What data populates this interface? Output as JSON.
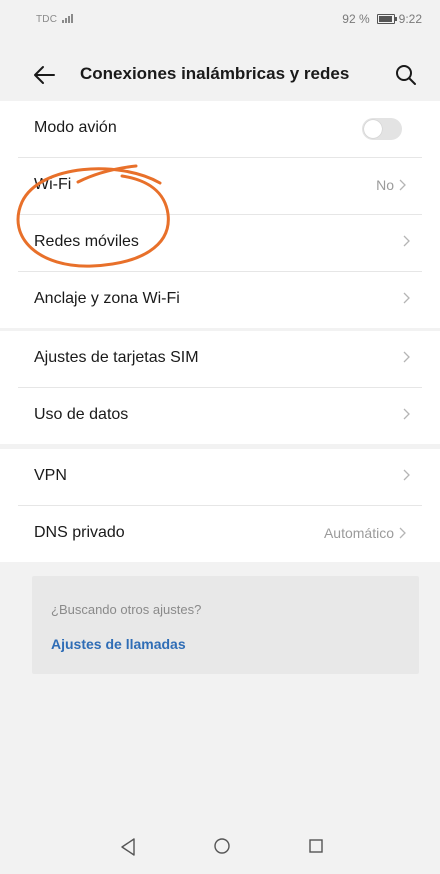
{
  "status_bar": {
    "carrier": "TDC",
    "battery": "92 %",
    "battery_level": 0.92,
    "time": "9:22"
  },
  "header": {
    "title": "Conexiones inalámbricas y redes",
    "back_icon": "arrow-left-icon",
    "search_icon": "search-icon"
  },
  "groups": [
    {
      "items": [
        {
          "label": "Modo avión",
          "control": "toggle",
          "toggle_on": false
        },
        {
          "label": "Wi-Fi",
          "value": "No"
        },
        {
          "label": "Redes móviles",
          "value": ""
        },
        {
          "label": "Anclaje y zona Wi-Fi",
          "value": ""
        }
      ]
    },
    {
      "items": [
        {
          "label": "Ajustes de tarjetas SIM",
          "value": ""
        },
        {
          "label": "Uso de datos",
          "value": ""
        }
      ]
    },
    {
      "items": [
        {
          "label": "VPN",
          "value": ""
        },
        {
          "label": "DNS privado",
          "value": "Automático"
        }
      ]
    }
  ],
  "suggestion": {
    "title": "¿Buscando otros ajustes?",
    "link": "Ajustes de llamadas"
  },
  "colors": {
    "background": "#f2f2f2",
    "card": "#ffffff",
    "link": "#2f6db6",
    "annotation": "#e8702a"
  },
  "nav_bar": {
    "back_icon": "triangle-back-icon",
    "home_icon": "circle-home-icon",
    "recent_icon": "square-recent-icon"
  }
}
